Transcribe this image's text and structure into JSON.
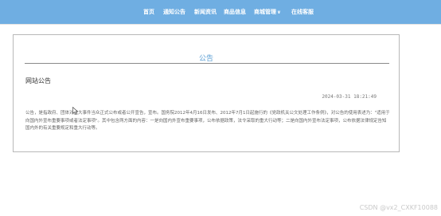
{
  "nav": {
    "items": [
      {
        "label": "首页",
        "dropdown": false
      },
      {
        "label": "通知公告",
        "dropdown": false
      },
      {
        "label": "新闻资讯",
        "dropdown": false
      },
      {
        "label": "商品信息",
        "dropdown": false
      },
      {
        "label": "商城管理",
        "dropdown": true
      },
      {
        "label": "在线客服",
        "dropdown": false
      }
    ]
  },
  "panel": {
    "title": "公告",
    "notice_title": "网站公告",
    "date": "2024-03-31 18:21:49",
    "body": "公告，是指政府、团体对重大事件当众正式公布或者公开宣告，宣布。国务院2012年4月16日发布、2012年7月1日起施行的《党政机关公文处理工作条例》，对公告的使用表述为：\"适用于向国内外宣布重要事项或者法定事项\"。其中包含两方面的内容：一是向国内外宣布重要事项，公布依据政策，法令采取的重大行动等；二是向国内外宣布法定事项，公布依据法律规定告知国内外的有关重要规定和重大行动等。"
  },
  "watermark": "CSDN @vx2_CXKF10088",
  "colors": {
    "nav_bg": "#6faee2",
    "accent": "#5b9fd4"
  }
}
